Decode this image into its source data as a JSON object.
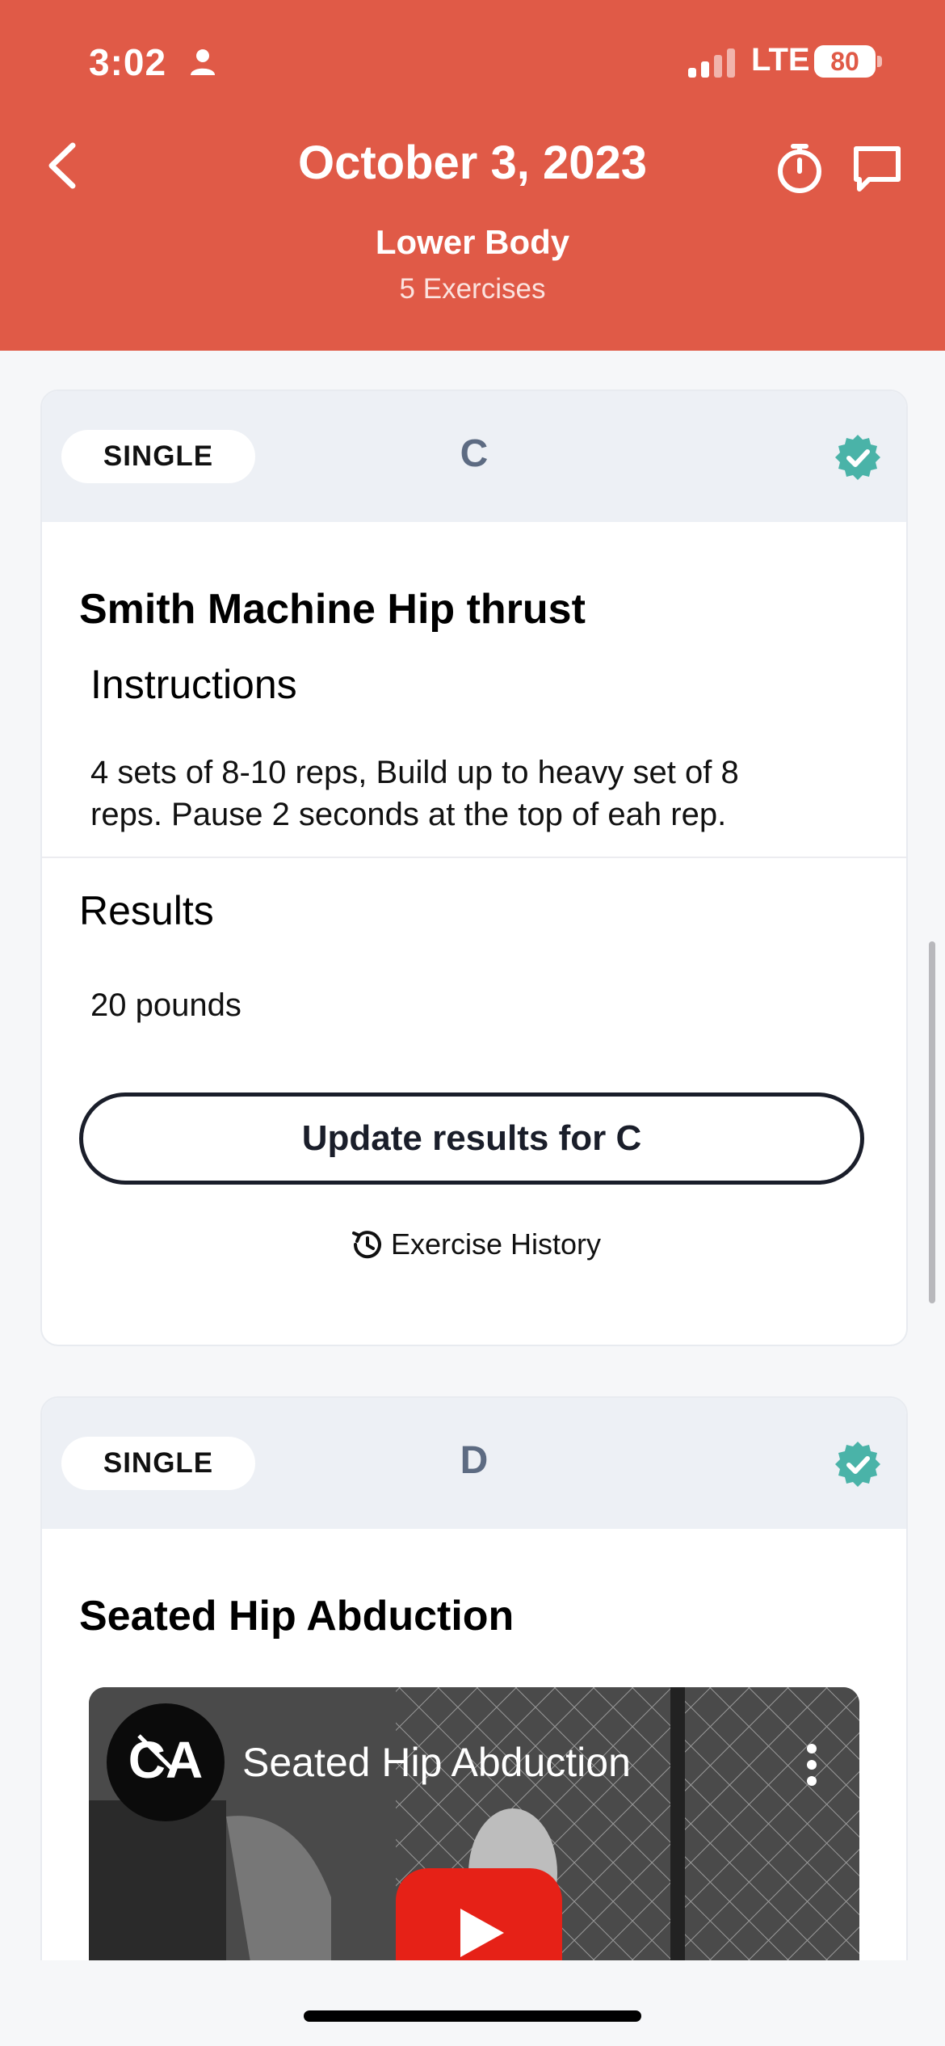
{
  "status_bar": {
    "time": "3:02",
    "network": "LTE",
    "battery": "80"
  },
  "header": {
    "date_title": "October 3, 2023",
    "workout_name": "Lower Body",
    "exercise_count": "5 Exercises"
  },
  "cards": [
    {
      "type": "SINGLE",
      "letter": "C",
      "completed": true,
      "exercise_name": "Smith Machine Hip thrust",
      "instructions_heading": "Instructions",
      "instructions_lines": [
        "4 sets of 8-10 reps, Build up to heavy set of 8",
        "reps. Pause 2 seconds at the top of eah rep."
      ],
      "results_heading": "Results",
      "result_value": "20 pounds",
      "update_button": "Update results for C",
      "history_link": "Exercise History"
    },
    {
      "type": "SINGLE",
      "letter": "D",
      "completed": true,
      "exercise_name": "Seated Hip Abduction",
      "video": {
        "title": "Seated Hip Abduction"
      }
    }
  ],
  "colors": {
    "header": "#e05a47",
    "check": "#4ab3a8",
    "card_head": "#edf0f5"
  }
}
